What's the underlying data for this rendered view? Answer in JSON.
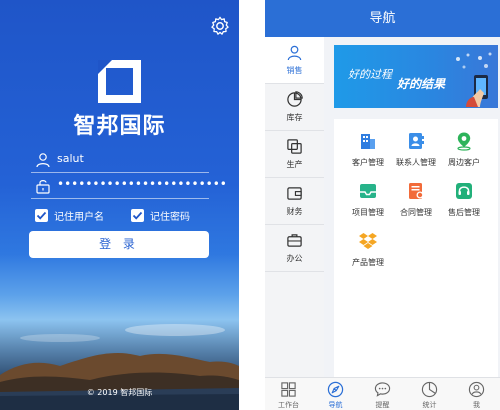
{
  "login": {
    "brand_name": "智邦国际",
    "username_value": "salut",
    "password_value": "••••••••••••••••••••••••",
    "remember_username_label": "记住用户名",
    "remember_password_label": "记住密码",
    "remember_username_checked": true,
    "remember_password_checked": true,
    "login_button_label": "登 录",
    "copyright": "© 2019 智邦国际"
  },
  "nav": {
    "title": "导航",
    "sidebar": {
      "items": [
        {
          "label": "销售",
          "icon": "person-icon",
          "active": true
        },
        {
          "label": "库存",
          "icon": "pie-chart-icon",
          "active": false
        },
        {
          "label": "生产",
          "icon": "production-icon",
          "active": false
        },
        {
          "label": "财务",
          "icon": "wallet-icon",
          "active": false
        },
        {
          "label": "办公",
          "icon": "briefcase-icon",
          "active": false
        }
      ]
    },
    "banner": {
      "text_1": "好的过程",
      "text_2": "好的结果"
    },
    "apps": [
      {
        "label": "客户管理",
        "icon": "building-icon",
        "color": "#2f7de0"
      },
      {
        "label": "联系人管理",
        "icon": "contact-card-icon",
        "color": "#3b8ee8"
      },
      {
        "label": "周边客户",
        "icon": "location-pin-icon",
        "color": "#2db35a"
      },
      {
        "label": "项目管理",
        "icon": "project-tray-icon",
        "color": "#27b38a"
      },
      {
        "label": "合同管理",
        "icon": "contract-icon",
        "color": "#f26b3a"
      },
      {
        "label": "售后管理",
        "icon": "headset-icon",
        "color": "#22b07a"
      },
      {
        "label": "产品管理",
        "icon": "dropbox-icon",
        "color": "#f5a623"
      }
    ],
    "tabs": [
      {
        "label": "工作台",
        "icon": "dashboard-icon",
        "active": false
      },
      {
        "label": "导航",
        "icon": "navigation-arrow-icon",
        "active": true
      },
      {
        "label": "提醒",
        "icon": "chat-bubble-icon",
        "active": false
      },
      {
        "label": "统计",
        "icon": "stats-icon",
        "active": false
      },
      {
        "label": "我",
        "icon": "profile-icon",
        "active": false
      }
    ],
    "accent": "#2b6fd6"
  }
}
